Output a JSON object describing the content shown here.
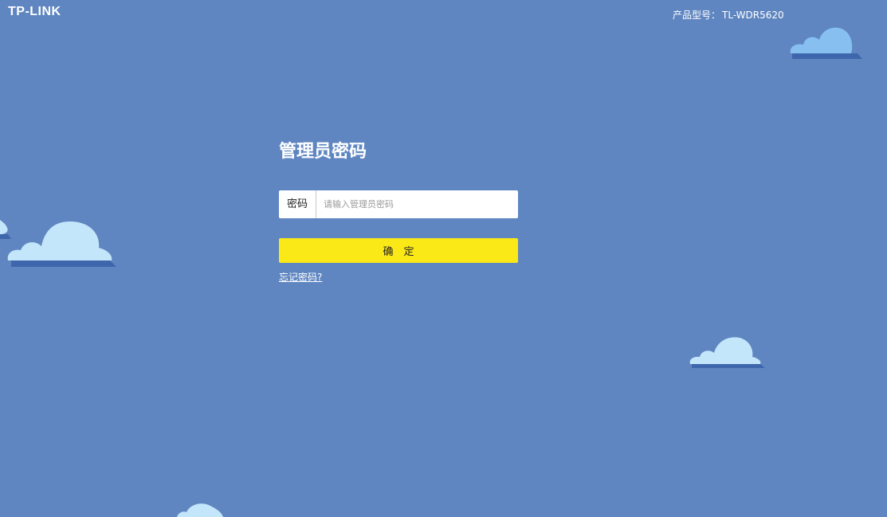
{
  "header": {
    "logo": "TP-LINK",
    "model_label": "产品型号：",
    "model_value": "TL-WDR5620"
  },
  "login": {
    "title": "管理员密码",
    "password_label": "密码",
    "password_placeholder": "请输入管理员密码",
    "password_value": "",
    "confirm_label": "确　定",
    "forgot_link": "忘记密码?"
  },
  "colors": {
    "background": "#5f86c1",
    "cloud_light": "#c4e6fa",
    "cloud_mid": "#86bff0",
    "cloud_shadow": "#3e66ac",
    "confirm_button": "#fbe817"
  },
  "icons": [
    "cloud-icon"
  ]
}
